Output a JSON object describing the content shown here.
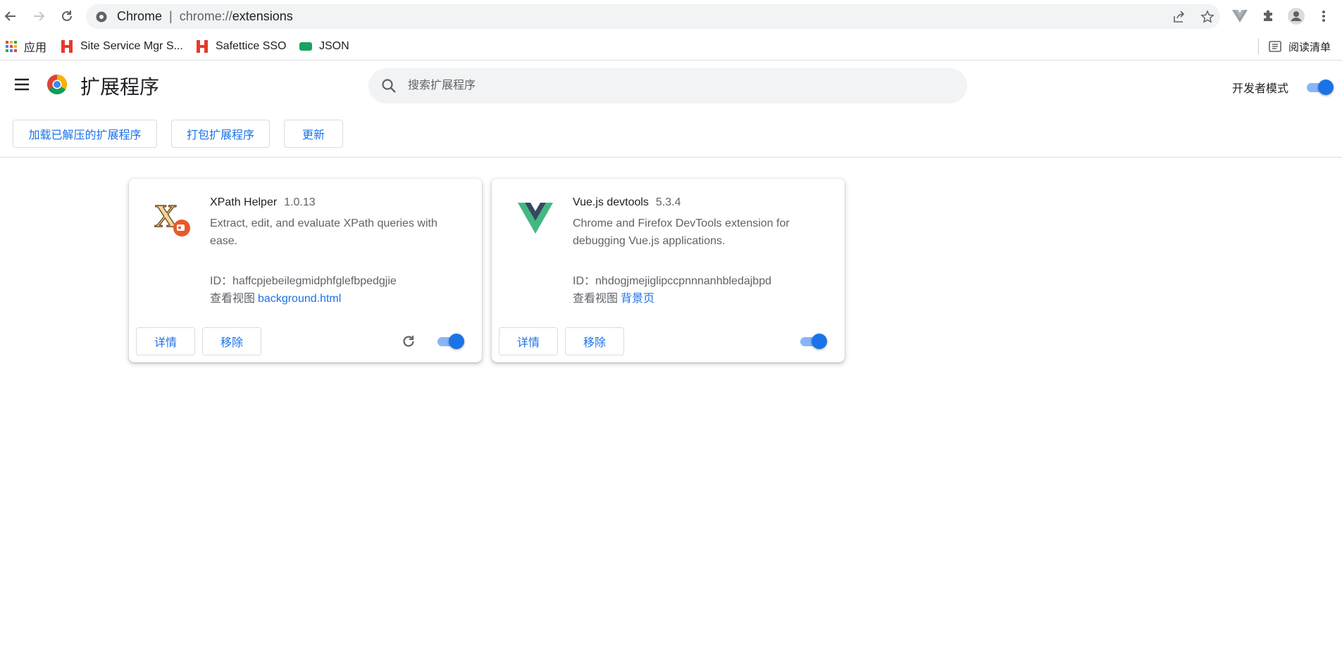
{
  "browser": {
    "url_host_label": "Chrome",
    "url_scheme": "chrome://",
    "url_path": "extensions"
  },
  "bookmarks": [
    {
      "label": "应用",
      "icon": "apps-grid-icon"
    },
    {
      "label": "Site Service Mgr S...",
      "icon": "huawei-h-icon"
    },
    {
      "label": "Safettice SSO",
      "icon": "huawei-h-icon"
    },
    {
      "label": "JSON",
      "icon": "json-icon"
    }
  ],
  "reading_list": "阅读清单",
  "header": {
    "title": "扩展程序",
    "search_placeholder": "搜索扩展程序",
    "dev_mode_label": "开发者模式",
    "dev_mode_on": true
  },
  "toolbar": {
    "load_unpacked": "加载已解压的扩展程序",
    "pack": "打包扩展程序",
    "update": "更新"
  },
  "extensions": [
    {
      "name": "XPath Helper",
      "version": "1.0.13",
      "description": "Extract, edit, and evaluate XPath queries with ease.",
      "id_label": "ID：",
      "id": "haffcpjebeilegmidphfglefbpedgjie",
      "views_label": "查看视图",
      "view_link": "background.html",
      "details": "详情",
      "remove": "移除",
      "enabled": true,
      "has_reload": true,
      "icon": "xpath-helper-icon"
    },
    {
      "name": "Vue.js devtools",
      "version": "5.3.4",
      "description": "Chrome and Firefox DevTools extension for debugging Vue.js applications.",
      "id_label": "ID：",
      "id": "nhdogjmejiglipccpnnnanhbledajbpd",
      "views_label": "查看视图",
      "view_link": "背景页",
      "details": "详情",
      "remove": "移除",
      "enabled": true,
      "has_reload": false,
      "icon": "vue-logo-icon"
    }
  ],
  "colors": {
    "accent": "#1a73e8",
    "toggle_track": "#8ab4f8",
    "omnibox_bg": "#f1f3f4"
  }
}
